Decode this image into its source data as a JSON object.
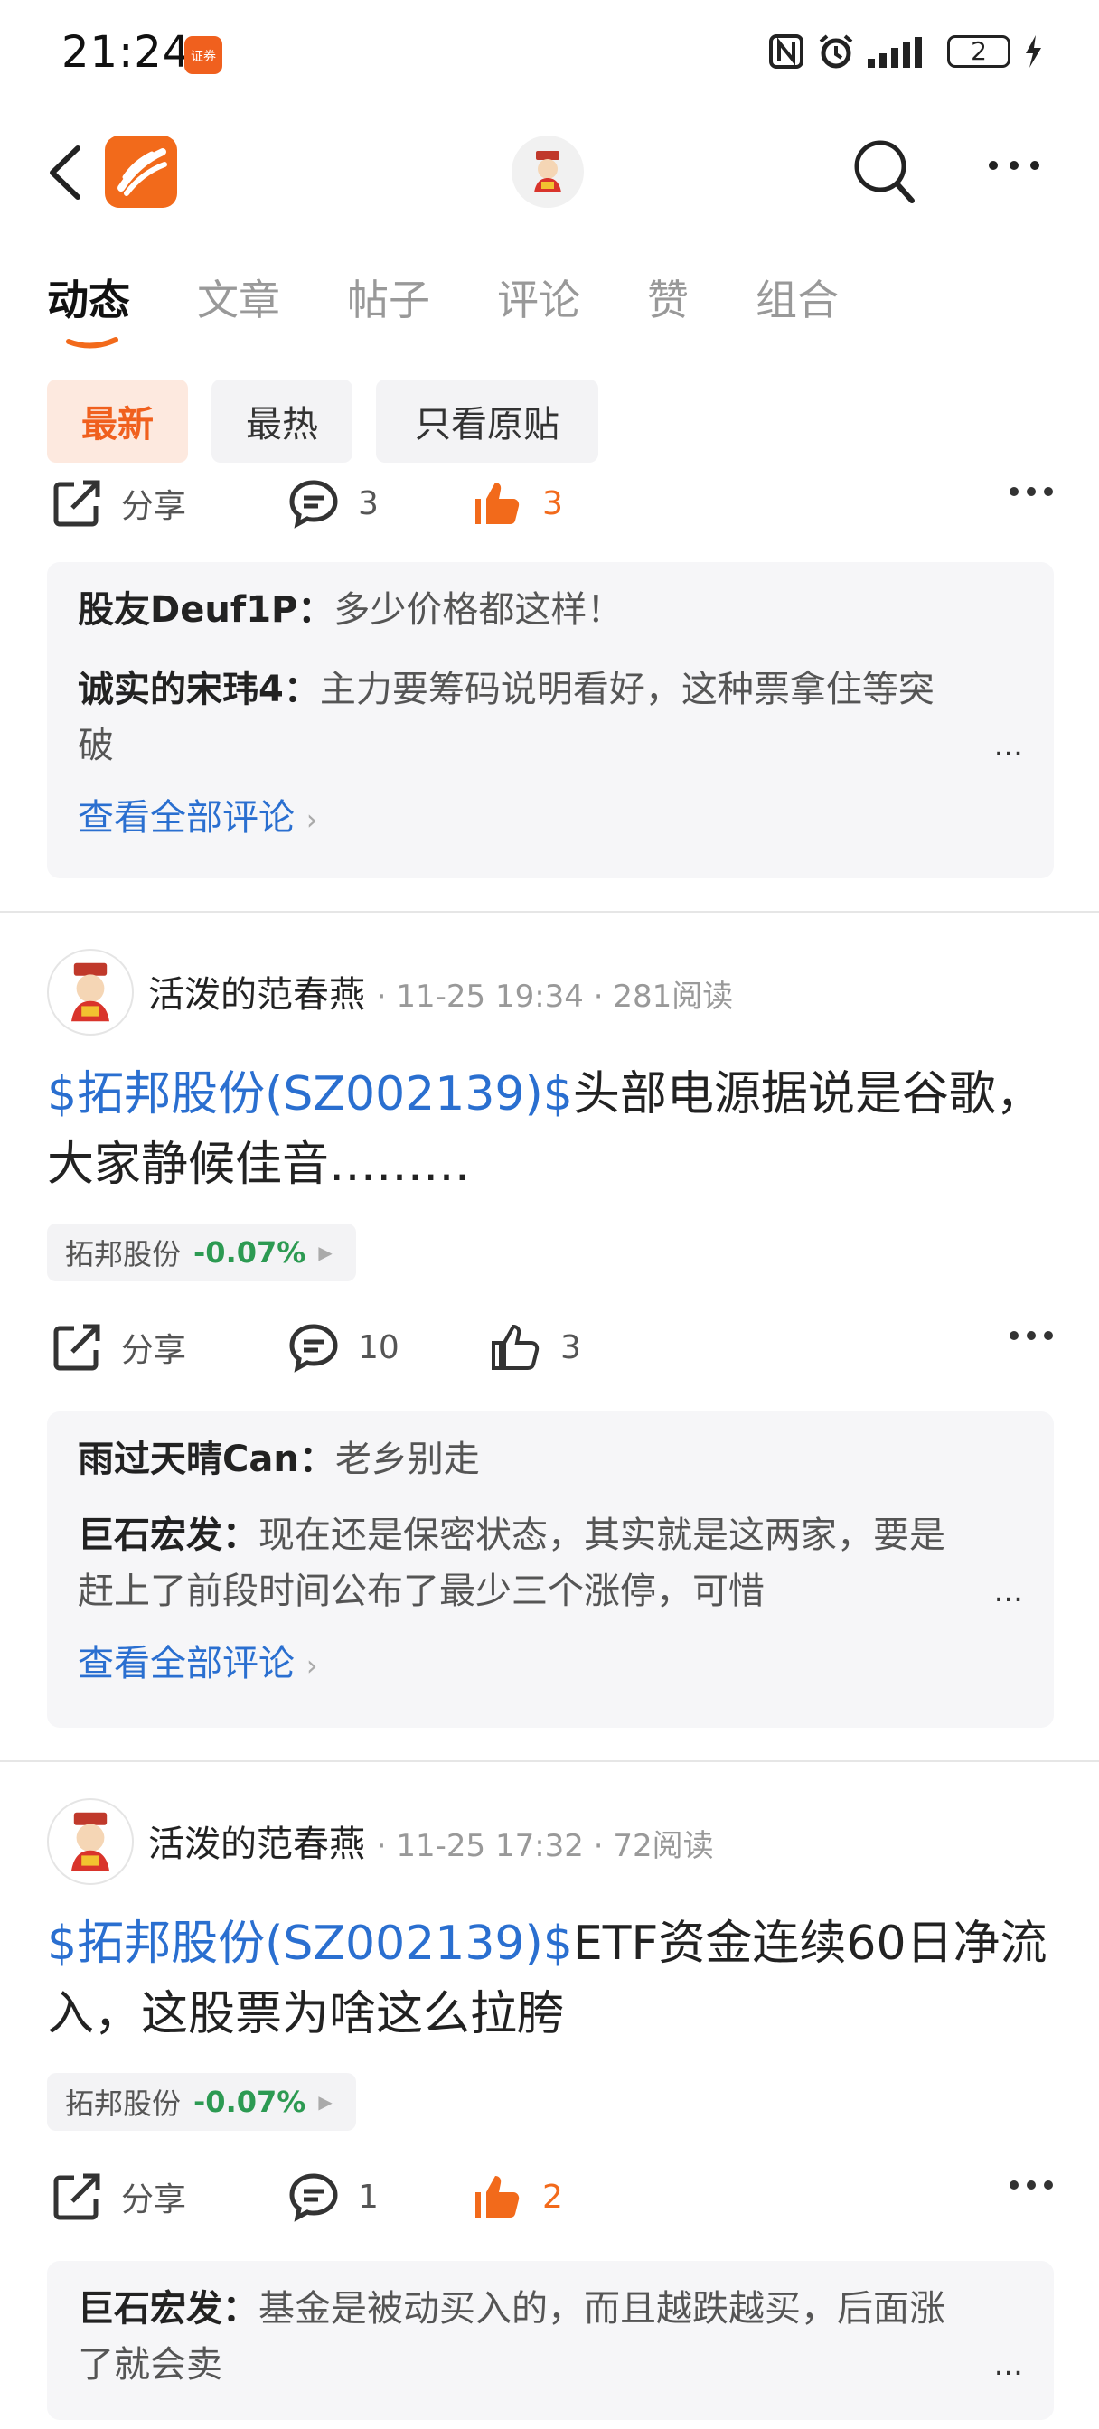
{
  "status_bar": {
    "time": "21:24",
    "app_badge": "证券",
    "battery": "2"
  },
  "tabs": [
    {
      "label": "动态"
    },
    {
      "label": "文章"
    },
    {
      "label": "帖子"
    },
    {
      "label": "评论"
    },
    {
      "label": "赞"
    },
    {
      "label": "组合"
    }
  ],
  "filters": [
    {
      "label": "最新"
    },
    {
      "label": "最热"
    },
    {
      "label": "只看原贴"
    }
  ],
  "colors": {
    "brand": "#f26a1b",
    "link": "#2a6fd0",
    "positive": "#2c9a52"
  },
  "posts": [
    {
      "actions": {
        "share": "分享",
        "comments": "3",
        "likes": "3"
      },
      "comments": [
        {
          "name": "股友Deuf1P：",
          "text": "多少价格都这样！"
        },
        {
          "name": "诚实的宋玮4：",
          "text": "主力要筹码说明看好，这种票拿住等突破"
        }
      ],
      "see_all": "查看全部评论",
      "more": "..."
    },
    {
      "author": "活泼的范春燕",
      "meta": "· 11-25 19:34 · 281阅读",
      "stock_link": "$拓邦股份(SZ002139)$",
      "text": "头部电源据说是谷歌，大家静候佳音………",
      "tag": {
        "name": "拓邦股份",
        "change": "-0.07%"
      },
      "actions": {
        "share": "分享",
        "comments": "10",
        "likes": "3"
      },
      "comments": [
        {
          "name": "雨过天晴Can：",
          "text": "老乡别走"
        },
        {
          "name": "巨石宏发：",
          "text": "现在还是保密状态，其实就是这两家，要是赶上了前段时间公布了最少三个涨停，可惜"
        }
      ],
      "see_all": "查看全部评论",
      "more": "..."
    },
    {
      "author": "活泼的范春燕",
      "meta": "· 11-25 17:32 · 72阅读",
      "stock_link": "$拓邦股份(SZ002139)$",
      "text": "ETF资金连续60日净流入，这股票为啥这么拉胯",
      "tag": {
        "name": "拓邦股份",
        "change": "-0.07%"
      },
      "actions": {
        "share": "分享",
        "comments": "1",
        "likes": "2"
      },
      "comments": [
        {
          "name": "巨石宏发：",
          "text": "基金是被动买入的，而且越跌越买，后面涨了就会卖"
        }
      ],
      "more": "..."
    }
  ]
}
